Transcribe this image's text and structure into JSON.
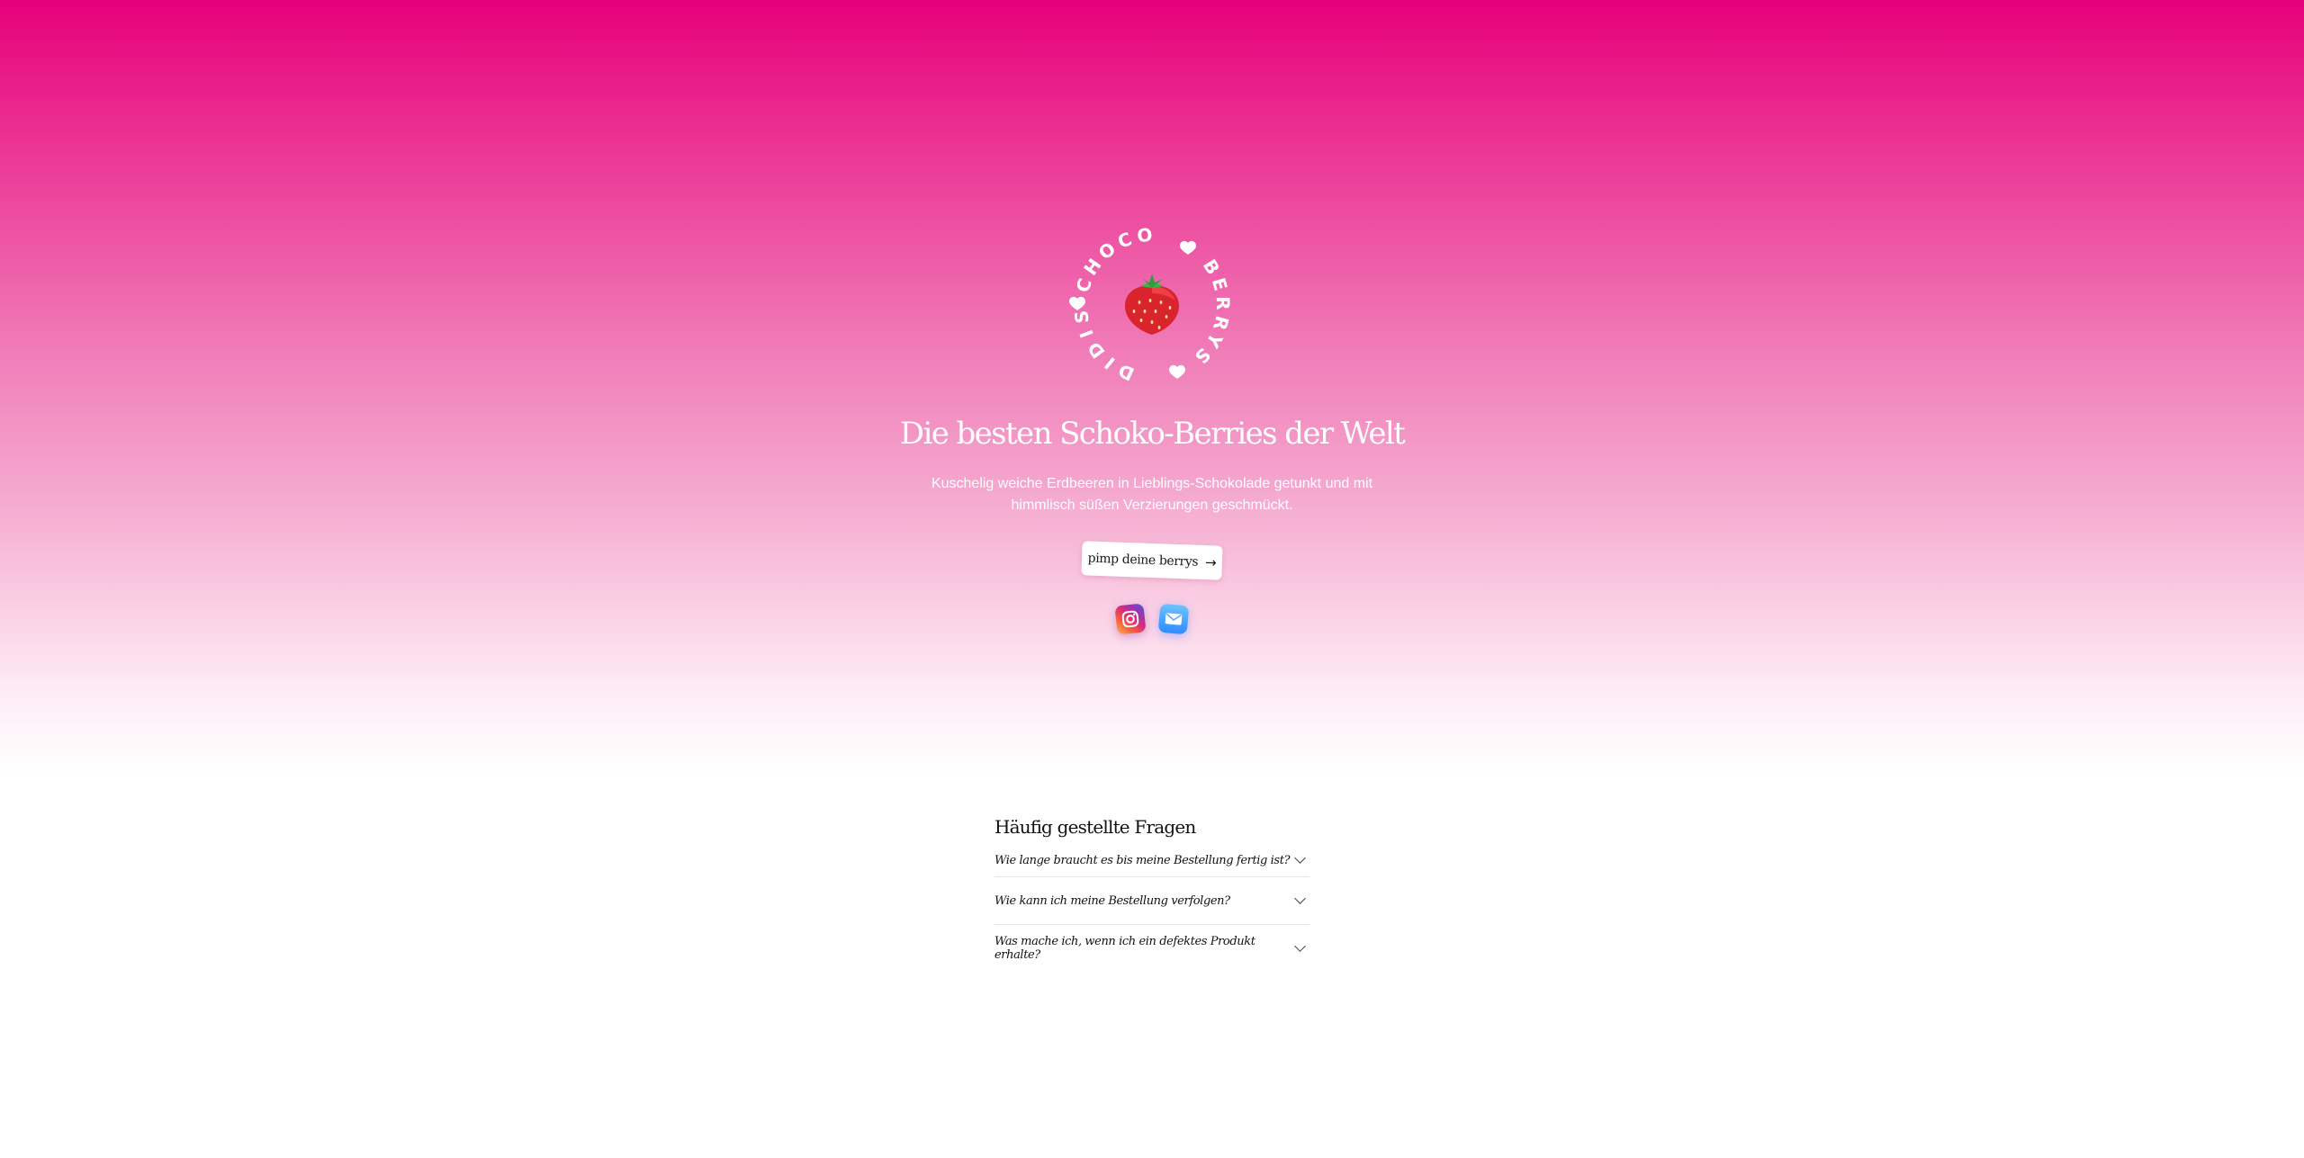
{
  "brand": {
    "logo_text_top": "CHOCO",
    "logo_text_right": "BERRYS",
    "logo_text_bottom": "DIDIS",
    "logo_emoji": "🍓"
  },
  "hero": {
    "headline": "Die besten Schoko-Berries der Welt",
    "subline": "Kuschelig weiche Erdbeeren in Lieblings-Schokolade getunkt und mit himmlisch süßen Verzierungen geschmückt.",
    "cta_label": "pimp deine berrys",
    "cta_icon": "arrow-right-icon",
    "background_top": "#e6007a",
    "background_bottom": "#ffffff"
  },
  "social": [
    {
      "name": "instagram-icon"
    },
    {
      "name": "mail-icon"
    }
  ],
  "faq": {
    "title": "Häufig gestellte Fragen",
    "items": [
      {
        "question": "Wie lange braucht es bis meine Bestellung fertig ist?"
      },
      {
        "question": "Wie kann ich meine Bestellung verfolgen?"
      },
      {
        "question": "Was mache ich, wenn ich ein defektes Produkt erhalte?"
      }
    ]
  }
}
